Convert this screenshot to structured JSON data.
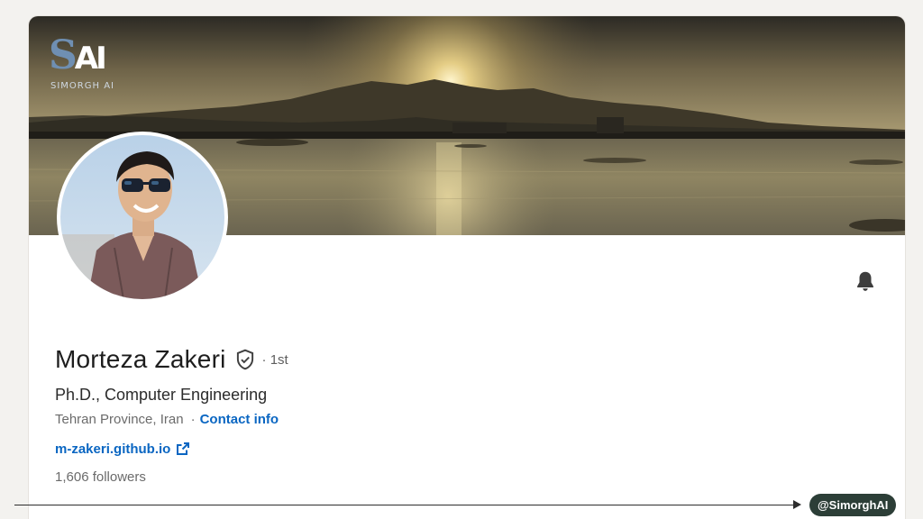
{
  "brand": {
    "logo_mark": "SAI",
    "logo_text": "SIMORGH AI"
  },
  "profile": {
    "name": "Morteza Zakeri",
    "verified_icon": "shield-check-icon",
    "degree": "· 1st",
    "headline": "Ph.D., Computer Engineering",
    "location": "Tehran Province, Iran",
    "location_separator": "·",
    "contact_label": "Contact info",
    "website": "m-zakeri.github.io",
    "website_icon": "external-link-icon",
    "followers": "1,606 followers",
    "notify_icon": "bell-icon"
  },
  "footer": {
    "handle": "@SimorghAI"
  },
  "colors": {
    "link": "#0a66c2",
    "badge": "#2c3e37",
    "page_bg": "#f3f2ef"
  }
}
